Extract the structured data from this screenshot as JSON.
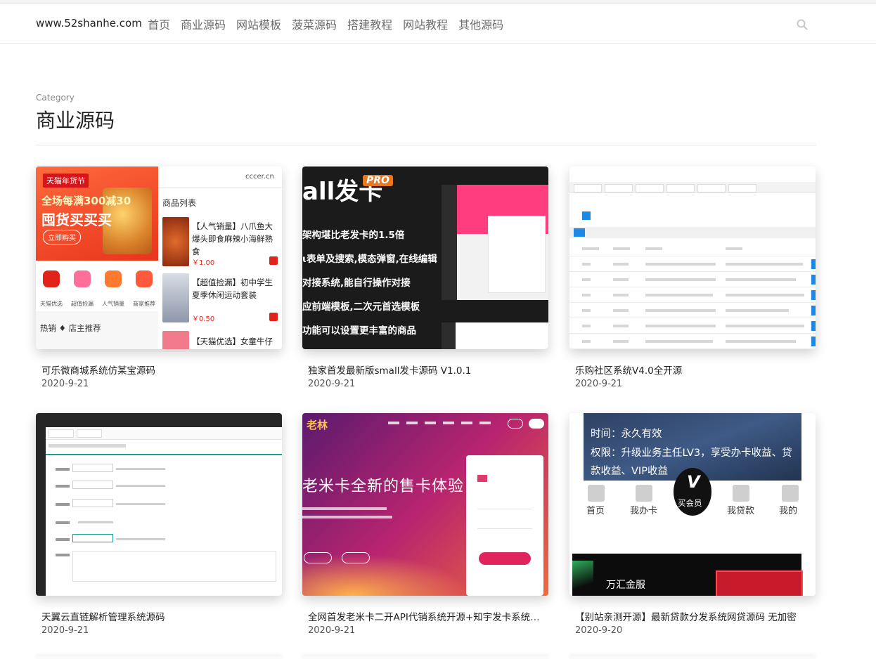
{
  "header": {
    "site": "www.52shanhe.com",
    "nav": [
      "首页",
      "商业源码",
      "网站模板",
      "菠菜源码",
      "搭建教程",
      "网站教程",
      "其他源码"
    ]
  },
  "category": {
    "kicker": "Category",
    "title": "商业源码"
  },
  "posts": [
    {
      "title": "可乐微商城系统仿某宝源码",
      "date": "2020-9-21"
    },
    {
      "title": "独家首发最新版small发卡源码 V1.0.1",
      "date": "2020-9-21"
    },
    {
      "title": "乐购社区系统V4.0全开源",
      "date": "2020-9-21"
    },
    {
      "title": "天翼云直链解析管理系统源码",
      "date": "2020-9-21"
    },
    {
      "title": "全网首发老米卡二开API代销系统开源+知宇发卡系统…",
      "date": "2020-9-21"
    },
    {
      "title": "【别站亲测开源】最新贷款分发系统网贷源码 无加密",
      "date": "2020-9-20"
    }
  ],
  "thumb1": {
    "banner_tag": "天猫年货节",
    "banner_line1": "全场每满300减30",
    "banner_line2": "囤货买买买",
    "banner_button": "立即购买",
    "site": "cccer.cn",
    "list_title": "商品列表",
    "products": [
      {
        "name": "【人气销量】八爪鱼大爆头即食麻辣小海鲜熟食",
        "price": "￥1.00"
      },
      {
        "name": "【超值捡漏】初中学生夏季休闲运动套装",
        "price": "￥0.50"
      },
      {
        "name": "【天猫优选】女童牛仔长裤子",
        "price": ""
      }
    ],
    "icons": [
      "天猫优选",
      "超值捡漏",
      "人气销量",
      "商家推荐"
    ],
    "hot": "热销 ♦ 店主推荐"
  },
  "thumb2": {
    "title": "all发卡",
    "badge": "PRO",
    "lines": [
      "架构堪比老发卡的1.5倍",
      "ɩ表单及搜索,模态弹窗,在线编辑",
      "对接系统,能自行操作对接",
      "应前端模板,二次元首选模板",
      "功能可以设置更丰富的商品"
    ]
  },
  "thumb5": {
    "logo": "老林",
    "headline": "老米卡全新的售卡体验"
  },
  "thumb6": {
    "line1": "时间：永久有效",
    "line2": "权限：升级业务主任LV3，享受办卡收益、贷款收益、VIP收益",
    "tabs": [
      "首页",
      "我办卡",
      "我贷款",
      "我的"
    ],
    "vip": "买会员",
    "vip_letter": "V",
    "brand": "万汇金服"
  }
}
